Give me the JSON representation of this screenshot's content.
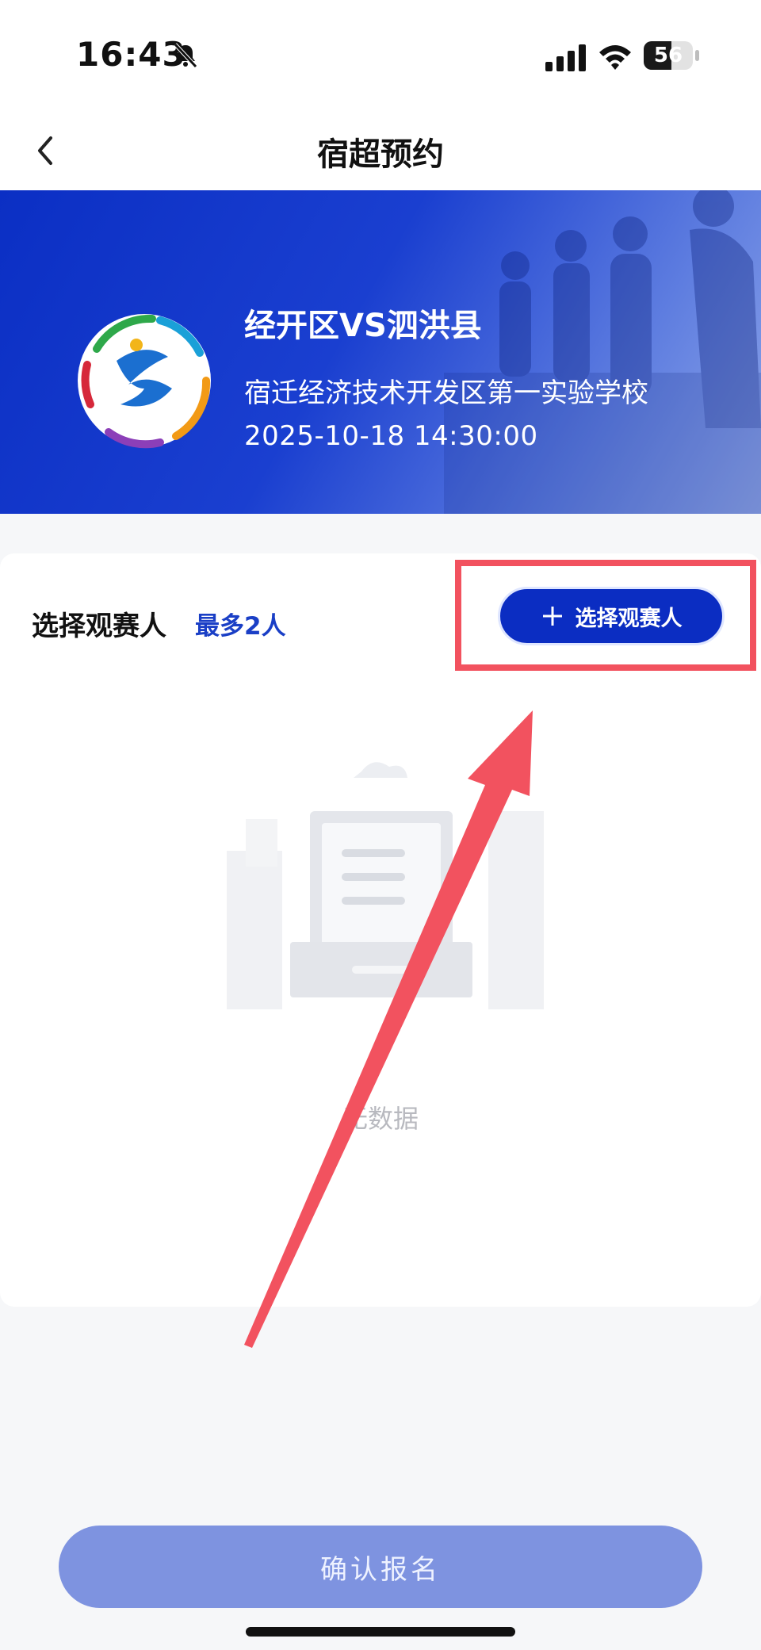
{
  "status_bar": {
    "time": "16:43",
    "battery_level": "56",
    "battery_fraction": 0.56,
    "icons": [
      "bell-slash-icon",
      "signal-icon",
      "wifi-icon",
      "battery-icon"
    ]
  },
  "nav": {
    "title": "宿超预约",
    "back_icon": "chevron-left-icon"
  },
  "banner": {
    "match_title": "经开区VS泗洪县",
    "venue": "宿迁经济技术开发区第一实验学校",
    "datetime": "2025-10-18 14:30:00"
  },
  "spectators": {
    "section_title": "选择观赛人",
    "limit_label": "最多2人",
    "select_button_label": "选择观赛人",
    "empty_text": "无数据"
  },
  "footer": {
    "confirm_label": "确认报名"
  },
  "colors": {
    "primary": "#0b2dc2",
    "accent_text": "#1a3fc6",
    "confirm_disabled": "#7e93e0",
    "annotation": "#f2525f",
    "background": "#f6f7f9"
  }
}
